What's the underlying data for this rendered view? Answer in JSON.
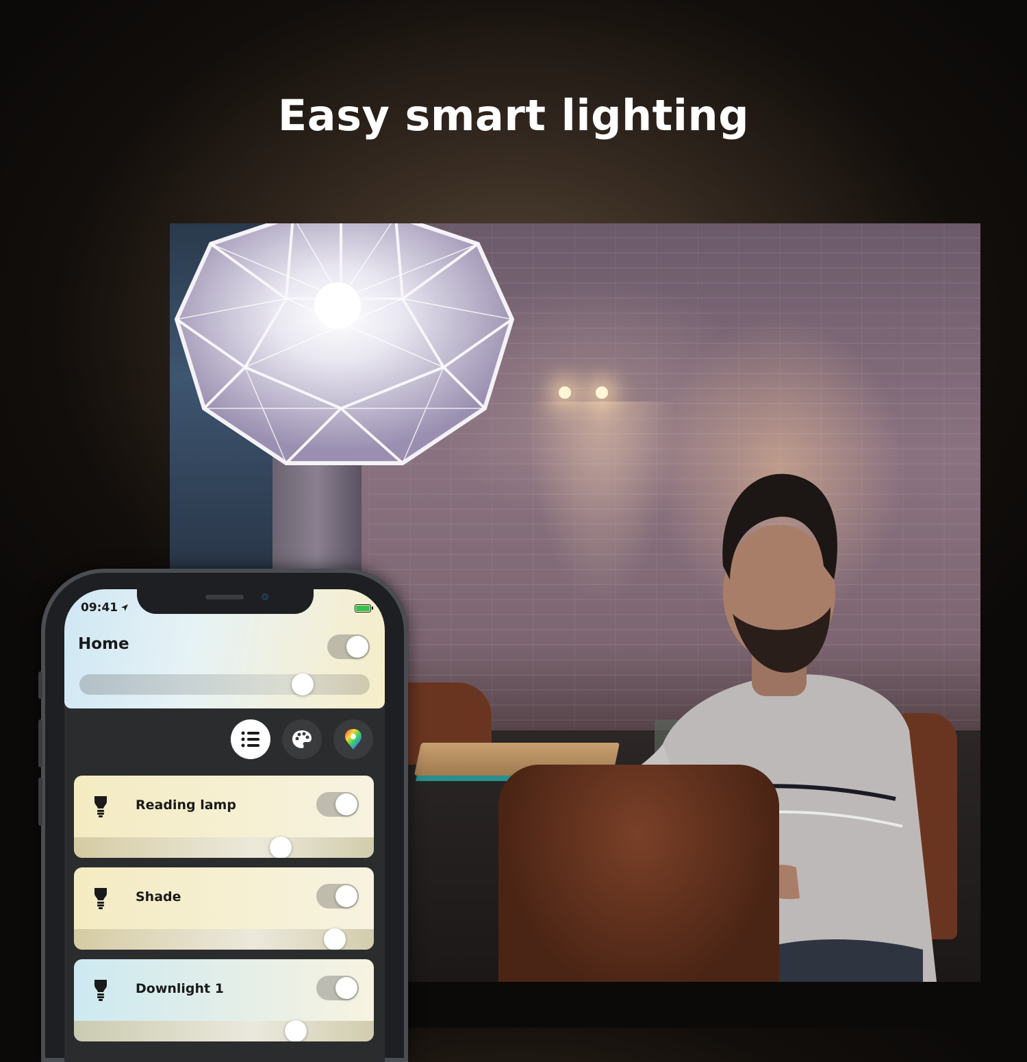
{
  "headline": "Easy smart lighting",
  "phone": {
    "status_time": "09:41",
    "home": {
      "title": "Home",
      "toggle_on": true,
      "brightness": 0.77
    },
    "view_buttons": [
      {
        "icon": "list-icon",
        "active": true
      },
      {
        "icon": "palette-icon",
        "active": false
      },
      {
        "icon": "color-picker-icon",
        "active": false
      }
    ],
    "lights": [
      {
        "label": "Reading lamp",
        "toggle_on": true,
        "brightness": 0.69,
        "color": "#f4ebc2"
      },
      {
        "label": "Shade",
        "toggle_on": true,
        "brightness": 0.87,
        "color": "#f4ebc2"
      },
      {
        "label": "Downlight 1",
        "toggle_on": true,
        "brightness": 0.74,
        "color": "#cde9f1"
      }
    ]
  }
}
